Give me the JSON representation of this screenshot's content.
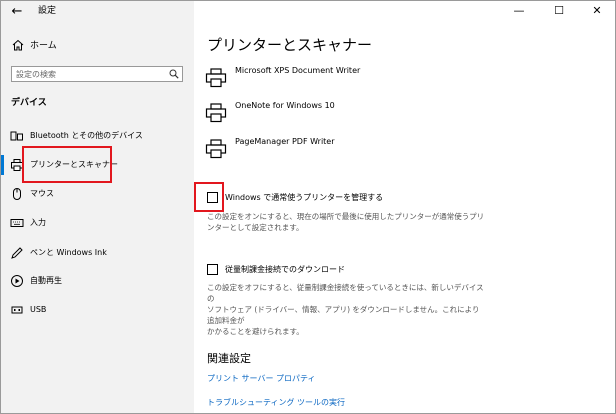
{
  "window": {
    "back_glyph": "←",
    "title": "設定",
    "controls": {
      "minimize": "—",
      "maximize": "☐",
      "close": "✕"
    }
  },
  "sidebar": {
    "home_label": "ホーム",
    "search_placeholder": "設定の検索",
    "section_title": "デバイス",
    "items": [
      {
        "label": "Bluetooth とその他のデバイス",
        "icon": "bluetooth-device-icon"
      },
      {
        "label": "プリンターとスキャナー",
        "icon": "printer-icon",
        "selected": true
      },
      {
        "label": "マウス",
        "icon": "mouse-icon"
      },
      {
        "label": "入力",
        "icon": "keyboard-icon"
      },
      {
        "label": "ペンと Windows Ink",
        "icon": "pen-icon"
      },
      {
        "label": "自動再生",
        "icon": "autoplay-icon"
      },
      {
        "label": "USB",
        "icon": "usb-icon"
      }
    ]
  },
  "main": {
    "title": "プリンターとスキャナー",
    "printers": [
      {
        "name": "Microsoft XPS Document Writer"
      },
      {
        "name": "OneNote for Windows 10"
      },
      {
        "name": "PageManager PDF Writer"
      }
    ],
    "default_printer": {
      "label": "Windows で通常使うプリンターを管理する",
      "checked": false,
      "description_line1": "この設定をオンにすると、現在の場所で最後に使用したプリンターが通常使うプリ",
      "description_line2": "ンターとして設定されます。"
    },
    "metered_download": {
      "label": "従量制課金接続でのダウンロード",
      "checked": false,
      "description_line1": "この設定をオフにすると、従量制課金接続を使っているときには、新しいデバイスの",
      "description_line2": "ソフトウェア (ドライバー、情報、アプリ) をダウンロードしません。これにより追加料金が",
      "description_line3": "かかることを避けられます。"
    },
    "related_title": "関連設定",
    "links": [
      {
        "label": "プリント サーバー プロパティ"
      },
      {
        "label": "トラブルシューティング ツールの実行"
      }
    ]
  },
  "colors": {
    "accent": "#0078d4",
    "link": "#0b67c2",
    "highlight_box": "#e2171e",
    "sidebar_bg": "#f2f2f2"
  }
}
